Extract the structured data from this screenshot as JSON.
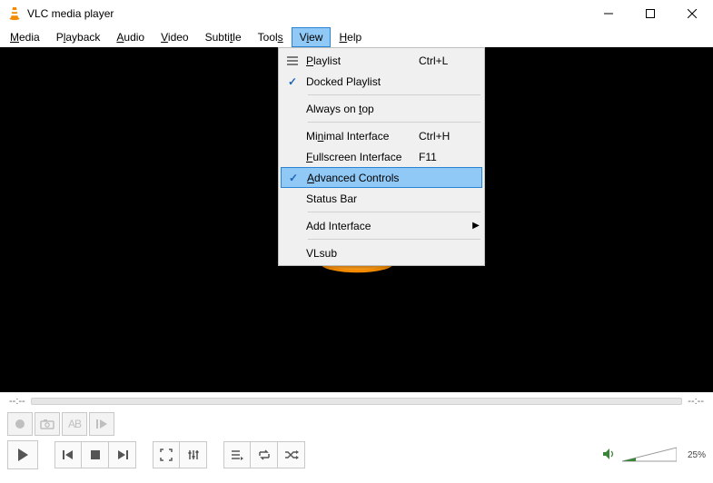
{
  "titlebar": {
    "title": "VLC media player"
  },
  "menus": {
    "media": "Media",
    "playback": "Playback",
    "audio": "Audio",
    "video": "Video",
    "subtitle": "Subtitle",
    "tools": "Tools",
    "view": "View",
    "help": "Help"
  },
  "view_menu": {
    "playlist": {
      "label": "Playlist",
      "shortcut": "Ctrl+L"
    },
    "docked_playlist": {
      "label": "Docked Playlist",
      "checked": true
    },
    "always_on_top": {
      "label": "Always on top"
    },
    "minimal_interface": {
      "label": "Minimal Interface",
      "shortcut": "Ctrl+H"
    },
    "fullscreen_interface": {
      "label": "Fullscreen Interface",
      "shortcut": "F11"
    },
    "advanced_controls": {
      "label": "Advanced Controls",
      "checked": true
    },
    "status_bar": {
      "label": "Status Bar"
    },
    "add_interface": {
      "label": "Add Interface"
    },
    "vlsub": {
      "label": "VLsub"
    }
  },
  "seek": {
    "time_left": "--:--",
    "time_right": "--:--"
  },
  "volume": {
    "percent_label": "25%",
    "percent_value": 25
  }
}
